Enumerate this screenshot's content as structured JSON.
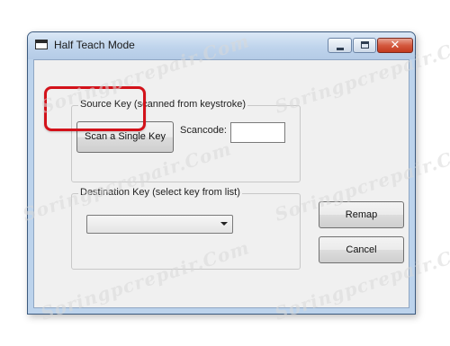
{
  "window": {
    "title": "Half Teach Mode",
    "close_glyph": "✕"
  },
  "source_group": {
    "legend": "Source Key (scanned from keystroke)",
    "scan_button": "Scan a Single Key",
    "scancode_label": "Scancode:",
    "scancode_value": ""
  },
  "destination_group": {
    "legend": "Destination Key (select key from list)",
    "selected_key": ""
  },
  "buttons": {
    "remap": "Remap",
    "cancel": "Cancel"
  },
  "watermark": "Soringpcrepair.Com",
  "colors": {
    "highlight": "#d3121a",
    "titlebar": "#bfd4ec",
    "close_button": "#c23a1e"
  },
  "icons": {
    "app": "window-icon",
    "minimize": "minimize-icon",
    "maximize": "maximize-icon",
    "close": "close-icon",
    "dropdown": "chevron-down-icon"
  }
}
